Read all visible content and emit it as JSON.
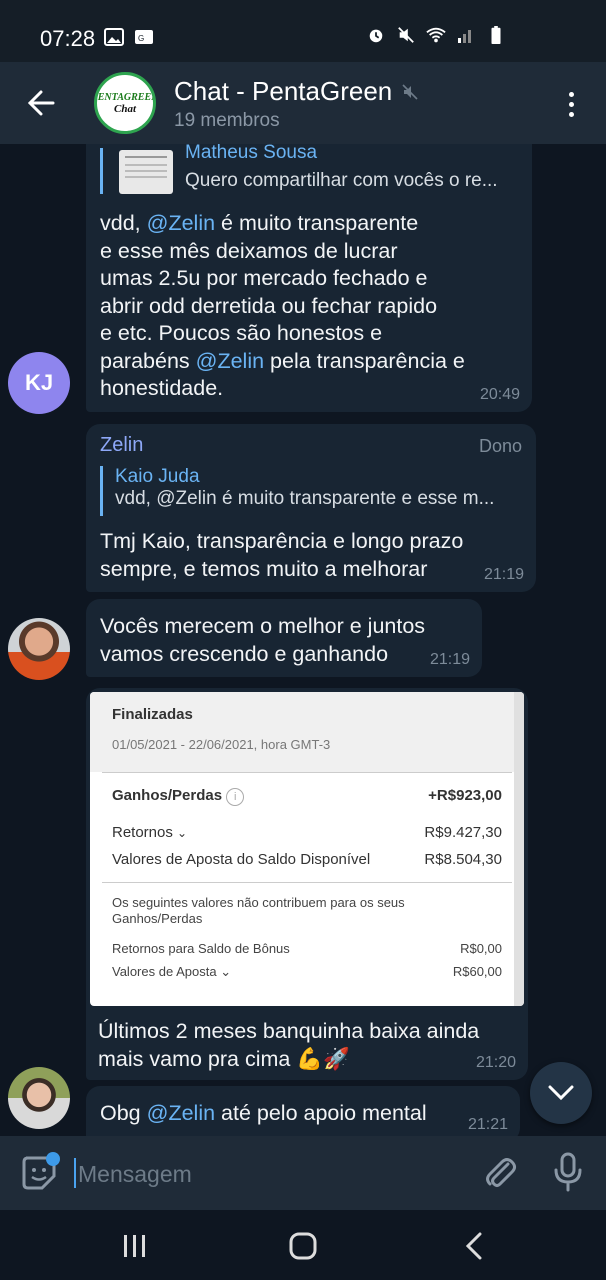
{
  "status_bar": {
    "time": "07:28"
  },
  "header": {
    "title": "Chat - PentaGreen",
    "subtitle": "19 membros",
    "avatar_top": "PENTAGREEN",
    "avatar_bottom": "Chat"
  },
  "messages": [
    {
      "reply_name": "Matheus Sousa",
      "reply_text": "Quero compartilhar com vocês o re...",
      "lines": [
        [
          "vdd, ",
          "@Zelin",
          " é muito transparente"
        ],
        [
          "e esse mês deixamos de lucrar"
        ],
        [
          "umas 2.5u por mercado fechado e"
        ],
        [
          "abrir odd derretida ou fechar rapido"
        ],
        [
          "e etc.  Poucos são honestos e"
        ],
        [
          "parabéns ",
          "@Zelin",
          " pela transparência e"
        ],
        [
          "honestidade."
        ]
      ],
      "time": "20:49",
      "avatar_initials": "KJ"
    },
    {
      "sender": "Zelin",
      "role": "Dono",
      "reply_name": "Kaio Juda",
      "reply_text": "vdd, @Zelin é muito transparente e esse m...",
      "line1": "Tmj Kaio, transparência e longo prazo",
      "line2": "sempre, e temos muito a melhorar",
      "time": "21:19"
    },
    {
      "line1": "Vocês merecem o melhor e juntos",
      "line2": "vamos crescendo e ganhando",
      "time": "21:19"
    },
    {
      "screenshot": {
        "title": "Finalizadas",
        "date": "01/05/2021 - 22/06/2021, hora GMT-3",
        "gains_label": "Ganhos/Perdas",
        "gains_value": "+R$923,00",
        "returns_label": "Retornos",
        "returns_value": "R$9.427,30",
        "stakes_label": "Valores de Aposta do Saldo Disponível",
        "stakes_value": "R$8.504,30",
        "note": "Os seguintes valores não contribuem para os seus Ganhos/Perdas",
        "bonus_label": "Retornos para Saldo de Bônus",
        "bonus_value": "R$0,00",
        "bet_label": "Valores de Aposta",
        "bet_value": "R$60,00"
      },
      "line1": "Últimos 2 meses banquinha baixa ainda",
      "line2": "mais vamo pra cima 💪🚀",
      "time": "21:20"
    },
    {
      "pre": "Obg ",
      "mention": "@Zelin",
      "post": " até pelo apoio mental",
      "time": "21:21"
    }
  ],
  "composer": {
    "placeholder": "Mensagem"
  }
}
